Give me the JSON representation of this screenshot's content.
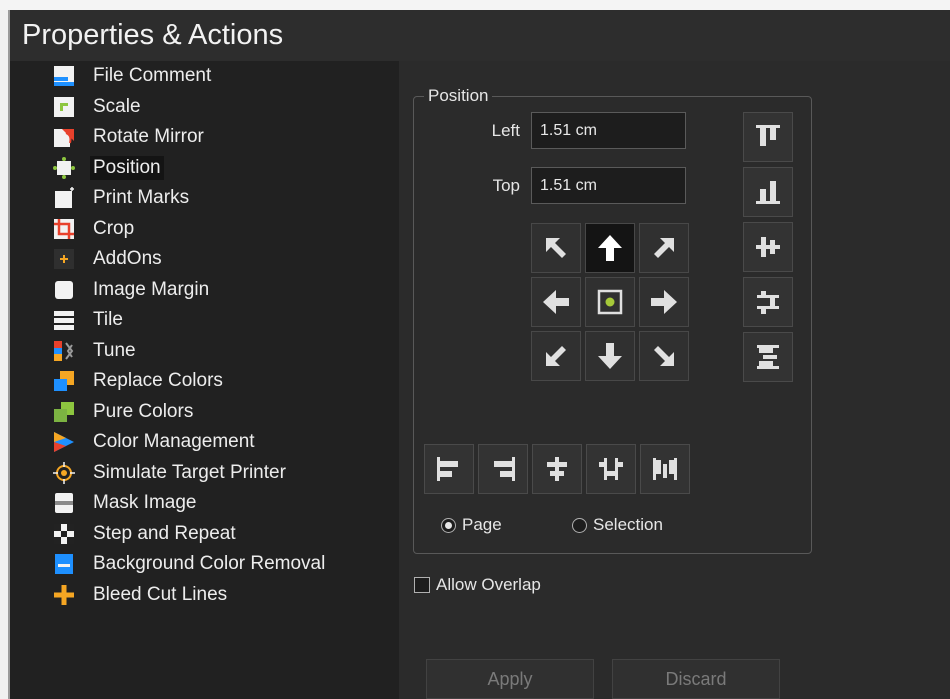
{
  "title": "Properties & Actions",
  "sidebar": {
    "items": [
      {
        "label": "File Comment",
        "icon": "file-comment-icon"
      },
      {
        "label": "Scale",
        "icon": "scale-icon"
      },
      {
        "label": "Rotate Mirror",
        "icon": "rotate-mirror-icon"
      },
      {
        "label": "Position",
        "icon": "position-icon",
        "selected": true
      },
      {
        "label": "Print Marks",
        "icon": "print-marks-icon"
      },
      {
        "label": "Crop",
        "icon": "crop-icon"
      },
      {
        "label": "AddOns",
        "icon": "addons-icon"
      },
      {
        "label": "Image Margin",
        "icon": "image-margin-icon"
      },
      {
        "label": "Tile",
        "icon": "tile-icon"
      },
      {
        "label": "Tune",
        "icon": "tune-icon"
      },
      {
        "label": "Replace Colors",
        "icon": "replace-colors-icon"
      },
      {
        "label": "Pure Colors",
        "icon": "pure-colors-icon"
      },
      {
        "label": "Color Management",
        "icon": "color-management-icon"
      },
      {
        "label": "Simulate Target Printer",
        "icon": "simulate-target-printer-icon"
      },
      {
        "label": "Mask Image",
        "icon": "mask-image-icon"
      },
      {
        "label": "Step and Repeat",
        "icon": "step-and-repeat-icon"
      },
      {
        "label": "Background Color Removal",
        "icon": "background-color-removal-icon"
      },
      {
        "label": "Bleed Cut Lines",
        "icon": "bleed-cut-lines-icon"
      }
    ]
  },
  "position": {
    "legend": "Position",
    "left_label": "Left",
    "left_value": "1.51 cm",
    "top_label": "Top",
    "top_value": "1.51 cm",
    "anchor_selected": "top-center",
    "radio_page": "Page",
    "radio_selection": "Selection",
    "selected_reference": "Page"
  },
  "allow_overlap": {
    "label": "Allow Overlap",
    "checked": false
  },
  "actions": {
    "apply": "Apply",
    "discard": "Discard"
  },
  "colors": {
    "accent_dot": "#a6c939",
    "background": "#212121",
    "panel": "#2b2b2b"
  }
}
